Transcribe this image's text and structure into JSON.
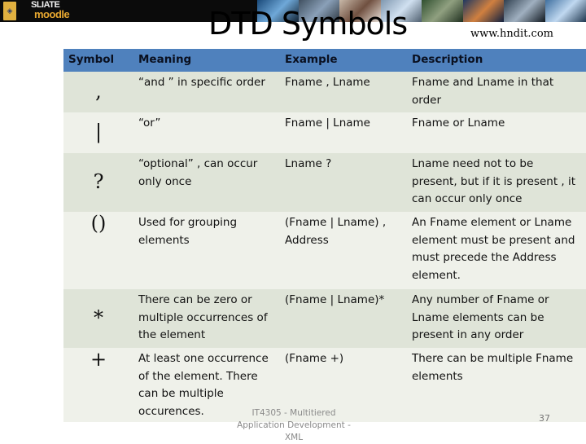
{
  "banner": {
    "logo_badge_icon": "shield-emblem-icon",
    "logo_line1": "SLIATE",
    "logo_line2": "moodle",
    "photo_strip": "banner-photos"
  },
  "slide": {
    "title": "DTD Symbols",
    "site_url": "www.hndit.com",
    "footer_course": "IT4305 - Multitiered Application Development - XML",
    "page_number": "37"
  },
  "table": {
    "headers": [
      "Symbol",
      "Meaning",
      "Example",
      "Description"
    ],
    "rows": [
      {
        "symbol": ",",
        "meaning": "“and ” in specific order",
        "example": "Fname ,  Lname",
        "description": "Fname and Lname in that order"
      },
      {
        "symbol": "|",
        "meaning": "“or”",
        "example": "Fname | Lname",
        "description": "Fname or Lname"
      },
      {
        "symbol": "?",
        "meaning": "“optional” , can occur only once",
        "example": "Lname ?",
        "description": "Lname need not to be present, but if it is present , it can occur only once"
      },
      {
        "symbol": "()",
        "meaning": "Used for grouping elements",
        "example": "(Fname | Lname) , Address",
        "description": "An Fname element or Lname element must be present and must precede the Address element."
      },
      {
        "symbol": "*",
        "meaning": "There can be zero or multiple occurrences of the element",
        "example": "(Fname | Lname)*",
        "description": "Any number of Fname or Lname elements can be present in any order"
      },
      {
        "symbol": "+",
        "meaning": "At least one occurrence of the element. There can be multiple occurences.",
        "example": "(Fname +)",
        "description": "There can be multiple Fname elements"
      }
    ]
  },
  "colors": {
    "header_bg": "#4f81bd",
    "row_odd": "#dfe4d8",
    "row_even": "#eff1ea",
    "banner_bg": "#0b0b0b",
    "logo_accent": "#e8a830"
  }
}
